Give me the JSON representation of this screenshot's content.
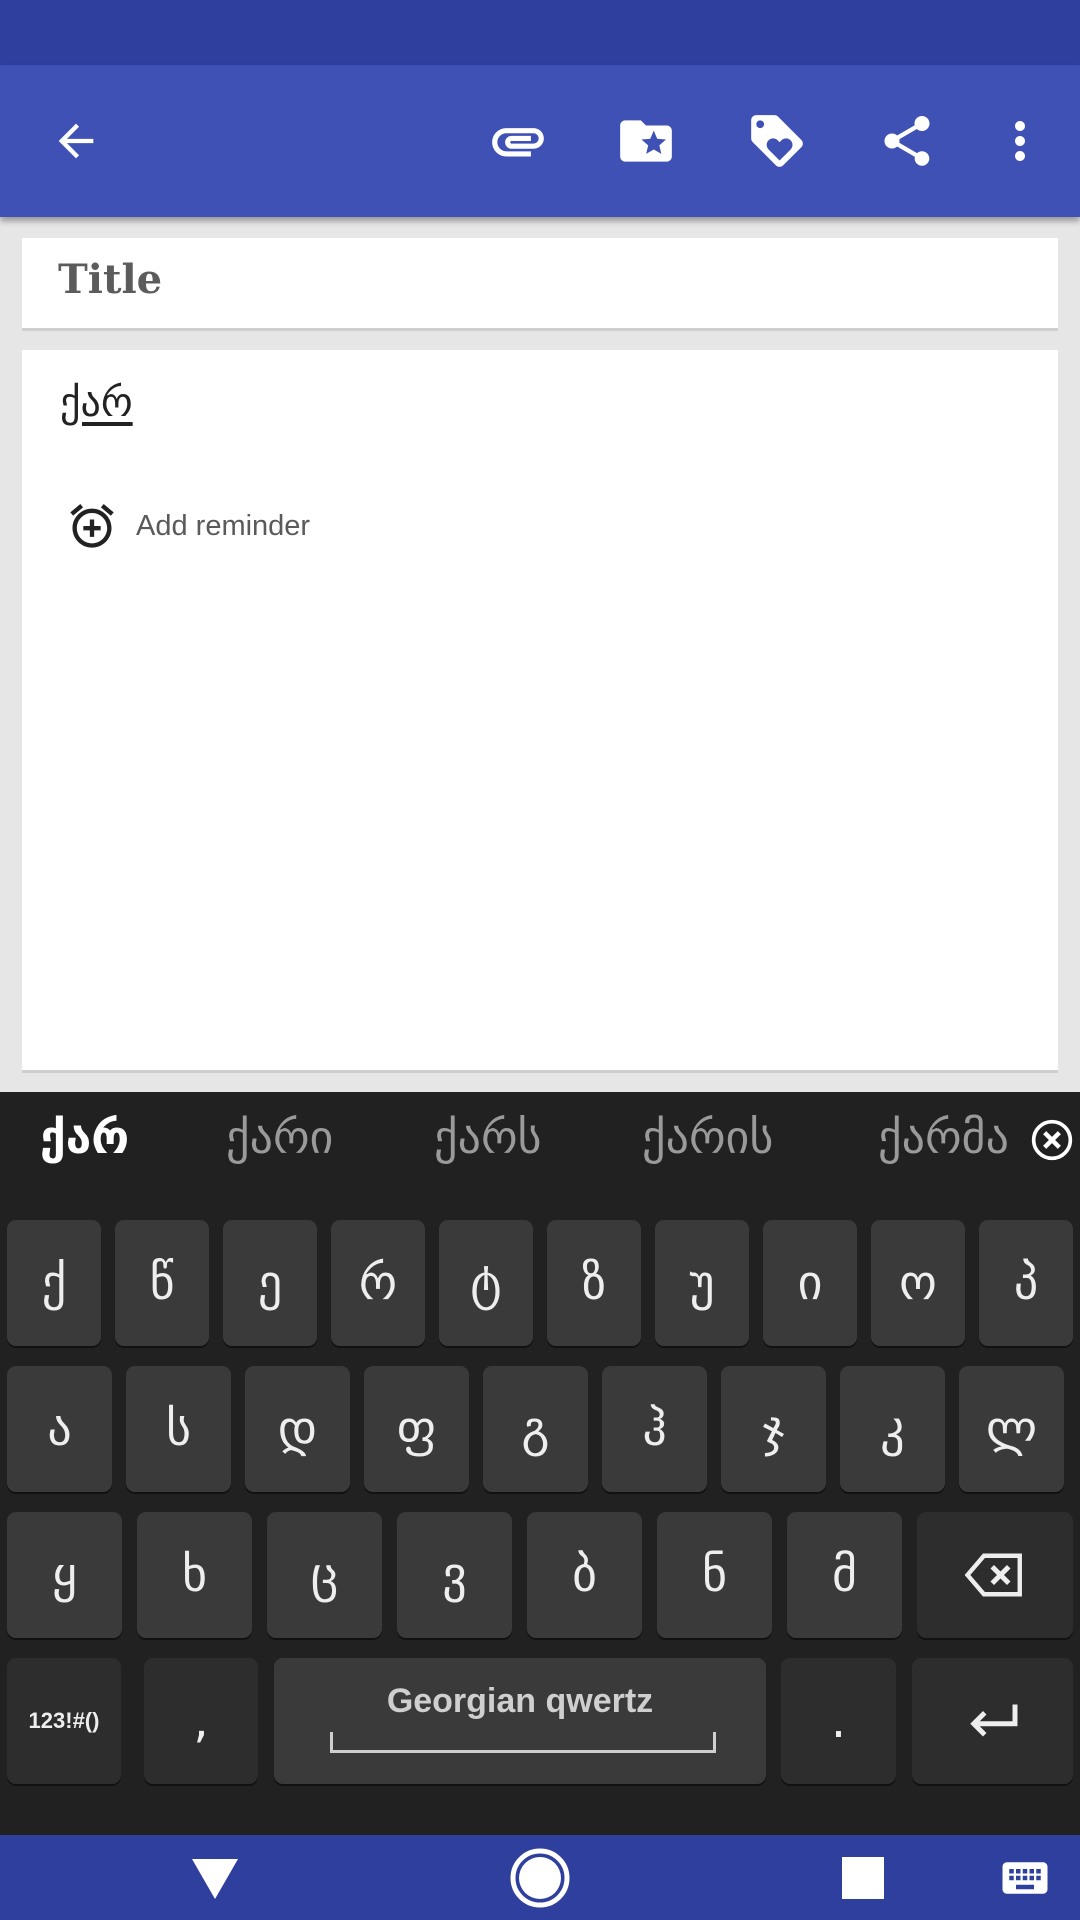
{
  "appbar": {
    "back_icon": "arrow-back-icon",
    "actions": [
      "paperclip-icon",
      "folder-star-icon",
      "tag-heart-icon",
      "share-icon",
      "more-vert-icon"
    ]
  },
  "note": {
    "title_placeholder": "Title",
    "content": "ქარ",
    "reminder_label": "Add reminder"
  },
  "keyboard": {
    "suggestions": [
      "ქარ",
      "ქარი",
      "ქარს",
      "ქარის",
      "ქარმა"
    ],
    "row1": [
      "ქ",
      "წ",
      "ე",
      "რ",
      "ტ",
      "ზ",
      "უ",
      "ი",
      "ო",
      "პ"
    ],
    "row2": [
      "ა",
      "ს",
      "დ",
      "ფ",
      "გ",
      "ჰ",
      "ჯ",
      "კ",
      "ლ"
    ],
    "row3": [
      "ყ",
      "ხ",
      "ც",
      "ვ",
      "ბ",
      "ნ",
      "მ"
    ],
    "symbols_label": "123!#()",
    "comma_label": ",",
    "space_label": "Georgian qwertz",
    "period_label": ".",
    "colors": {
      "bg": "#212121",
      "key": "#3a3a3a",
      "text": "#eeeeee"
    }
  },
  "colors": {
    "primary": "#3f51b5",
    "primary_dark": "#2f3f9e"
  }
}
